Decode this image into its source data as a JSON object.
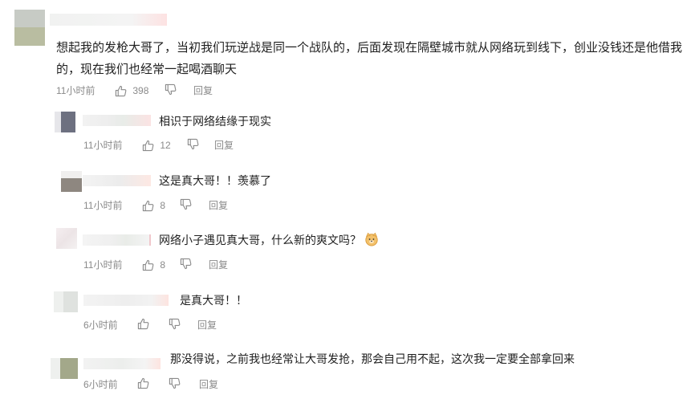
{
  "main_comment": {
    "text": "想起我的发枪大哥了，当初我们玩逆战是同一个战队的，后面发现在隔壁城市就从网络玩到线下，创业没钱还是他借我的，现在我们也经常一起喝酒聊天",
    "time": "11小时前",
    "like_count": "398",
    "reply_label": "回复"
  },
  "replies": [
    {
      "text": "相识于网络结缘于现实",
      "time": "11小时前",
      "like_count": "12",
      "reply_label": "回复"
    },
    {
      "text": "这是真大哥！！羡慕了",
      "time": "11小时前",
      "like_count": "8",
      "reply_label": "回复"
    },
    {
      "text": "网络小子遇见真大哥，什么新的爽文吗？",
      "time": "11小时前",
      "like_count": "8",
      "reply_label": "回复",
      "emoji": "doge-emoji"
    },
    {
      "text": "是真大哥！！",
      "time": "6小时前",
      "like_count": "",
      "reply_label": "回复"
    },
    {
      "text": "那没得说，之前我也经常让大哥发抢，那会自己用不起，这次我一定要全部拿回来",
      "time": "6小时前",
      "like_count": "",
      "reply_label": "回复"
    }
  ],
  "icons": {
    "like": "thumbs-up-icon",
    "dislike": "thumbs-down-icon"
  },
  "colors": {
    "text": "#1f1f1f",
    "meta": "#8a8a8a",
    "background": "#ffffff"
  }
}
